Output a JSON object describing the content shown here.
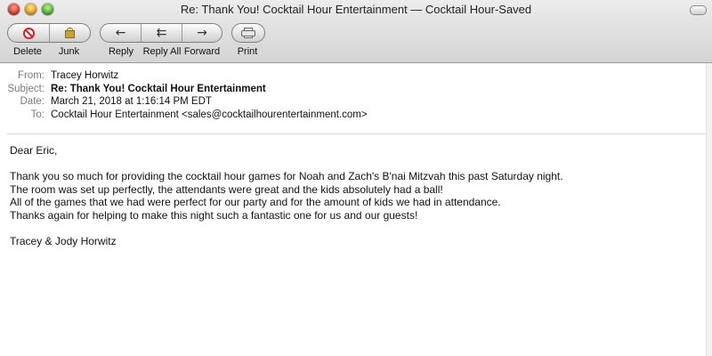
{
  "window": {
    "title": "Re: Thank You! Cocktail Hour Entertainment — Cocktail Hour-Saved"
  },
  "toolbar": {
    "delete_label": "Delete",
    "junk_label": "Junk",
    "reply_label": "Reply",
    "reply_all_label": "Reply All",
    "forward_label": "Forward",
    "print_label": "Print"
  },
  "headers": {
    "from_label": "From:",
    "from_value": "Tracey Horwitz",
    "subject_label": "Subject:",
    "subject_value": "Re: Thank You! Cocktail Hour Entertainment",
    "date_label": "Date:",
    "date_value": "March 21, 2018 at 1:16:14 PM EDT",
    "to_label": "To:",
    "to_value": "Cocktail Hour Entertainment <sales@cocktailhourentertainment.com>"
  },
  "message": {
    "greeting": "Dear Eric,",
    "line1": "Thank you so much for providing the cocktail hour games for Noah and Zach's B'nai Mitzvah this past Saturday night.",
    "line2": "The room was set up perfectly, the attendants were great and the kids absolutely had a ball!",
    "line3": "All of the games that we had were perfect for our party and for the amount of kids we had in attendance.",
    "line4": "Thanks again for helping to make this night such a fantastic one for us and our guests!",
    "signature": "Tracey & Jody Horwitz"
  },
  "icons": {
    "delete": "delete-icon",
    "junk": "junk-icon",
    "reply": "reply-arrow-icon",
    "reply_all": "reply-all-arrow-icon",
    "forward": "forward-arrow-icon",
    "print": "printer-icon"
  },
  "colors": {
    "delete_red": "#d2232a",
    "header_label_gray": "#7a7a7a"
  }
}
